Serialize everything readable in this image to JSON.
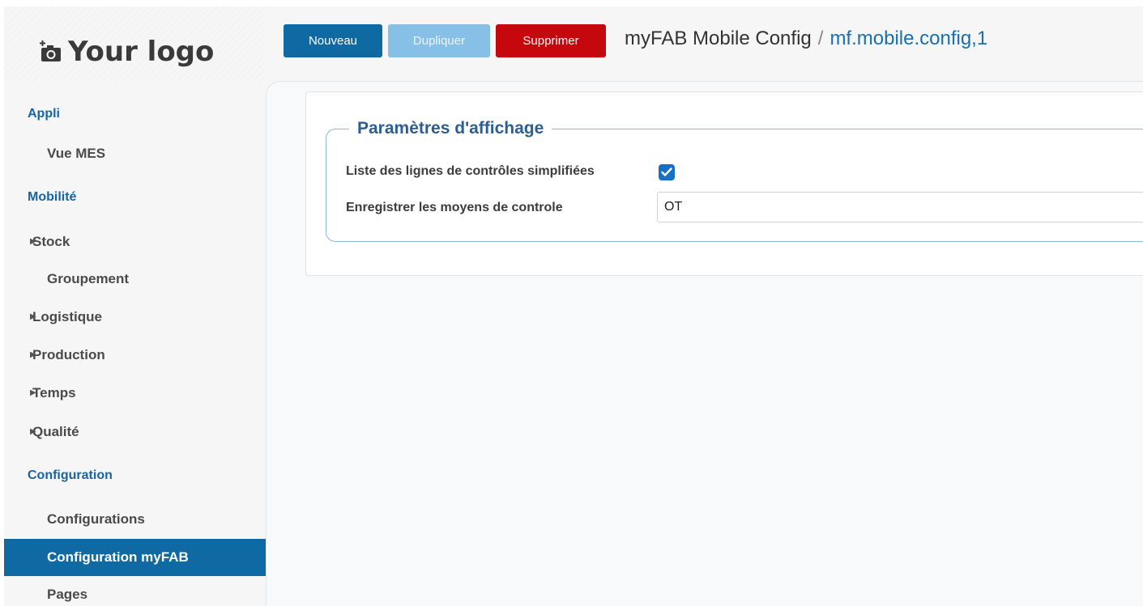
{
  "logo": {
    "text": "Your logo",
    "icon": "camera-plus-icon"
  },
  "sidebar": {
    "sections": [
      {
        "label": "Appli"
      },
      {
        "label": "Mobilité"
      },
      {
        "label": "Configuration"
      }
    ],
    "items": [
      {
        "label": "Vue MES",
        "expandable": false
      },
      {
        "label": "Stock",
        "expandable": true
      },
      {
        "label": "Groupement",
        "expandable": false
      },
      {
        "label": "Logistique",
        "expandable": true
      },
      {
        "label": "Production",
        "expandable": true
      },
      {
        "label": "Temps",
        "expandable": true
      },
      {
        "label": "Qualité",
        "expandable": true
      },
      {
        "label": "Configurations",
        "expandable": false
      },
      {
        "label": "Configuration myFAB",
        "expandable": false,
        "active": true
      },
      {
        "label": "Pages",
        "expandable": false
      }
    ],
    "arrow_glyph": "▶"
  },
  "toolbar": {
    "new_label": "Nouveau",
    "duplicate_label": "Dupliquer",
    "delete_label": "Supprimer"
  },
  "breadcrumb": {
    "model": "myFAB Mobile Config",
    "separator": "/",
    "record": "mf.mobile.config,1"
  },
  "form": {
    "group_title": "Paramètres d'affichage",
    "fields": {
      "simplified_label": "Liste des lignes de contrôles simplifiées",
      "simplified_checked": true,
      "means_label": "Enregistrer les moyens de controle",
      "means_value": "OT"
    }
  },
  "colors": {
    "primary": "#0f6aa3",
    "danger": "#c4080e",
    "disabled": "#86c0e6",
    "section_text": "#1a63a5",
    "record_link": "#1a6fb0"
  }
}
